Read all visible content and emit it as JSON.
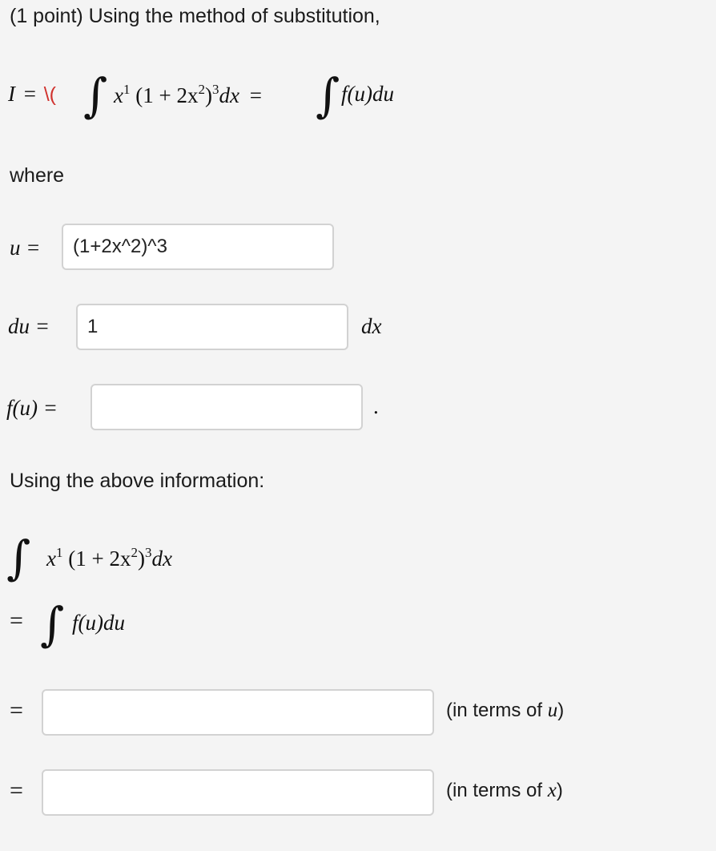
{
  "header": {
    "text": "(1 point) Using the method of substitution,"
  },
  "integral_definition": {
    "lhs": "I",
    "equals": "=",
    "delimiter": "\\(",
    "integrand_x": "x",
    "exp_1": "1",
    "factor": "(1 + 2x",
    "exp_2": "2",
    "close": ")",
    "exp_3": "3",
    "dx": "dx",
    "equals2": "=",
    "f_u_du": "f(u)du"
  },
  "where_label": "where",
  "u_row": {
    "label": "u =",
    "value": "(1+2x^2)^3"
  },
  "du_row": {
    "label": "du =",
    "value": "1",
    "suffix": "dx"
  },
  "fu_row": {
    "label": "f(u) =",
    "value": "",
    "suffix": "."
  },
  "using_label": "Using the above information:",
  "derivation": {
    "integrand_x": "x",
    "exp_1": "1",
    "factor": "(1 + 2x",
    "exp_2": "2",
    "close": ")",
    "exp_3": "3",
    "dx": "dx",
    "equals": "=",
    "f_u_du": "f(u)du"
  },
  "answer_u": {
    "equals": "=",
    "value": "",
    "note_prefix": "(in terms of ",
    "note_var": "u",
    "note_suffix": ")"
  },
  "answer_x": {
    "equals": "=",
    "value": "",
    "note_prefix": "(in terms of ",
    "note_var": "x",
    "note_suffix": ")"
  },
  "colors": {
    "background": "#f4f4f4",
    "input_border": "#d2d2d2",
    "delimiter_red": "#d0312d"
  }
}
